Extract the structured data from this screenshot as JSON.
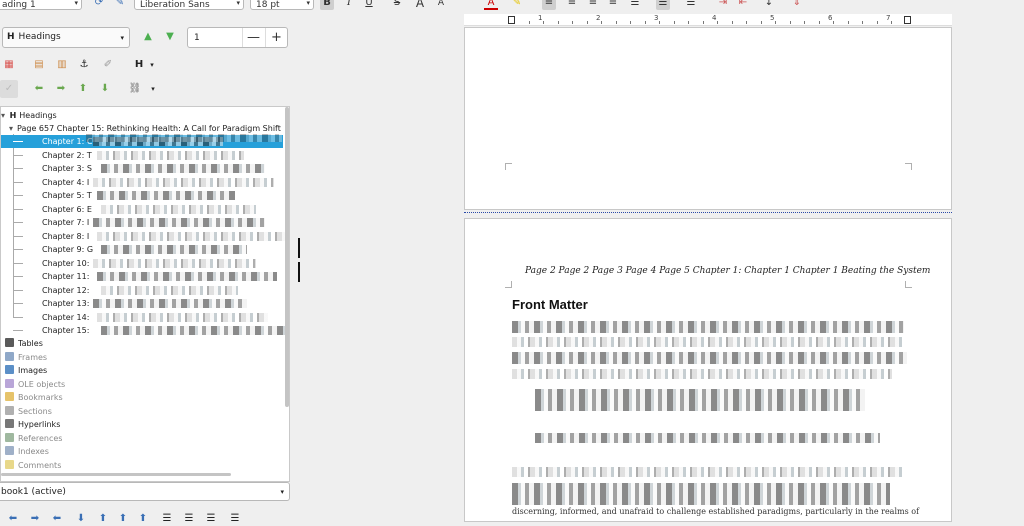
{
  "toolbar": {
    "para_style_value": "ading 1",
    "font_name_value": "Liberation Sans",
    "font_size_value": "18 pt",
    "bold_label": "B",
    "italic_label": "I",
    "underline_label": "U",
    "strike_label": "S",
    "grow_label": "A",
    "shrink_label": "A"
  },
  "navigator": {
    "category_value": "Headings",
    "spin_value": "1",
    "spin_minus": "—",
    "spin_plus": "+",
    "tree": {
      "root_label": "Headings",
      "page_row": "Page 657 Chapter 15: Rethinking Health: A Call for Paradigm Shift",
      "chapters": [
        "Chapter 1: C",
        "Chapter 2: T",
        "Chapter 3: S",
        "Chapter 4: I",
        "Chapter 5: T",
        "Chapter 6: E",
        "Chapter 7: I",
        "Chapter 8: I",
        "Chapter 9: G",
        "Chapter 10:",
        "Chapter 11:",
        "Chapter 12:",
        "Chapter 13:",
        "Chapter 14:",
        "Chapter 15:"
      ],
      "categories": [
        {
          "label": "Tables",
          "muted": false,
          "color": "#5a5a5a"
        },
        {
          "label": "Frames",
          "muted": true,
          "color": "#8fa8c8"
        },
        {
          "label": "Images",
          "muted": false,
          "color": "#5b8fc7"
        },
        {
          "label": "OLE objects",
          "muted": true,
          "color": "#b9a6d8"
        },
        {
          "label": "Bookmarks",
          "muted": true,
          "color": "#e6c36a"
        },
        {
          "label": "Sections",
          "muted": true,
          "color": "#b0b0b0"
        },
        {
          "label": "Hyperlinks",
          "muted": false,
          "color": "#777777"
        },
        {
          "label": "References",
          "muted": true,
          "color": "#9fb89f"
        },
        {
          "label": "Indexes",
          "muted": true,
          "color": "#9fb0c8"
        },
        {
          "label": "Comments",
          "muted": true,
          "color": "#e8d88a"
        }
      ]
    },
    "document_value": "book1 (active)"
  },
  "document": {
    "header_text": "Page 2  Page 2  Page 3  Page 4  Page 5 Chapter 1: Chapter 1 Chapter 1 Beating the System",
    "front_matter_heading": "Front Matter",
    "body_fragment": "discerning, informed, and unafraid to challenge established paradigms, particularly in the realms of"
  },
  "ruler": {
    "numbers": [
      "1",
      "2",
      "3",
      "4",
      "5",
      "6",
      "7"
    ]
  }
}
